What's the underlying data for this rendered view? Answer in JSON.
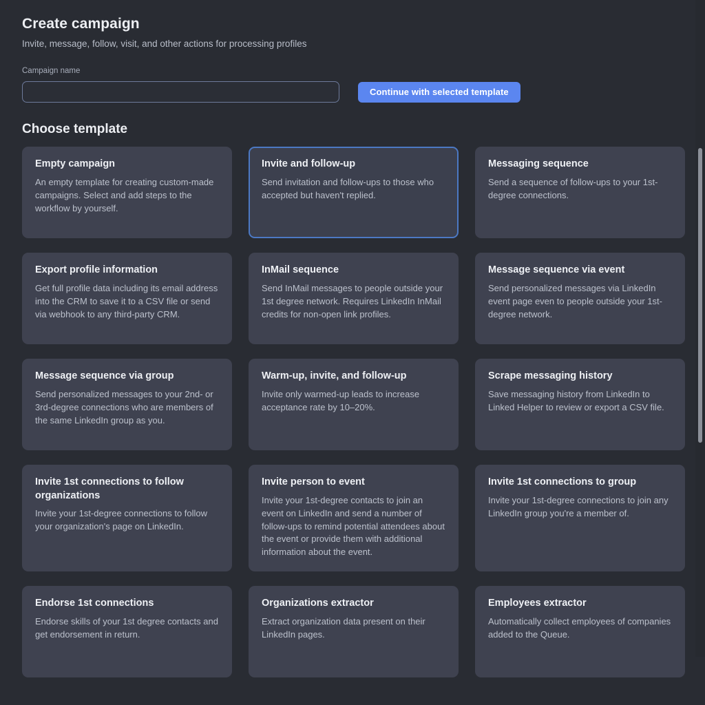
{
  "header": {
    "title": "Create campaign",
    "subtitle": "Invite, message, follow, visit, and other actions for processing profiles"
  },
  "form": {
    "campaign_name_label": "Campaign name",
    "campaign_name_value": "",
    "campaign_name_placeholder": "",
    "continue_button_label": "Continue with selected template"
  },
  "templates_section": {
    "title": "Choose template",
    "selected_index": 1,
    "cards": [
      {
        "title": "Empty campaign",
        "description": "An empty template for creating custom-made campaigns. Select and add steps to the workflow by yourself.",
        "selected": false
      },
      {
        "title": "Invite and follow-up",
        "description": "Send invitation and follow-ups to those who accepted but haven't replied.",
        "selected": true
      },
      {
        "title": "Messaging sequence",
        "description": "Send a sequence of follow-ups to your 1st-degree connections.",
        "selected": false
      },
      {
        "title": "Export profile information",
        "description": "Get full profile data including its email address into the CRM to save it to a CSV file or send via webhook to any third-party CRM.",
        "selected": false
      },
      {
        "title": "InMail sequence",
        "description": "Send InMail messages to people outside your 1st degree network. Requires LinkedIn InMail credits for non-open link profiles.",
        "selected": false
      },
      {
        "title": "Message sequence via event",
        "description": "Send personalized messages via LinkedIn event page even to people outside your 1st-degree network.",
        "selected": false
      },
      {
        "title": "Message sequence via group",
        "description": "Send personalized messages to your 2nd- or 3rd-degree connections who are members of the same LinkedIn group as you.",
        "selected": false
      },
      {
        "title": "Warm-up, invite, and follow-up",
        "description": "Invite only warmed-up leads to increase acceptance rate by 10–20%.",
        "selected": false
      },
      {
        "title": "Scrape messaging history",
        "description": "Save messaging history from LinkedIn to Linked Helper to review or export a CSV file.",
        "selected": false
      },
      {
        "title": "Invite 1st connections to follow organizations",
        "description": "Invite your 1st-degree connections to follow your organization's page on LinkedIn.",
        "selected": false
      },
      {
        "title": "Invite person to event",
        "description": "Invite your 1st-degree contacts to join an event on LinkedIn and send a number of follow-ups to remind potential attendees about the event or provide them with additional information about the event.",
        "selected": false
      },
      {
        "title": "Invite 1st connections to group",
        "description": "Invite your 1st-degree connections to join any LinkedIn group you're a member of.",
        "selected": false
      },
      {
        "title": "Endorse 1st connections",
        "description": "Endorse skills of your 1st degree contacts and get endorsement in return.",
        "selected": false
      },
      {
        "title": "Organizations extractor",
        "description": "Extract organization data present on their LinkedIn pages.",
        "selected": false
      },
      {
        "title": "Employees extractor",
        "description": "Automatically collect employees of companies added to the Queue.",
        "selected": false
      }
    ]
  },
  "colors": {
    "page_background": "#292c33",
    "card_background": "#3f4250",
    "selected_border": "#4c79c4",
    "accent_button": "#5b86f0",
    "input_border": "#6e7b9c",
    "scrollbar_thumb": "#8c9099"
  }
}
